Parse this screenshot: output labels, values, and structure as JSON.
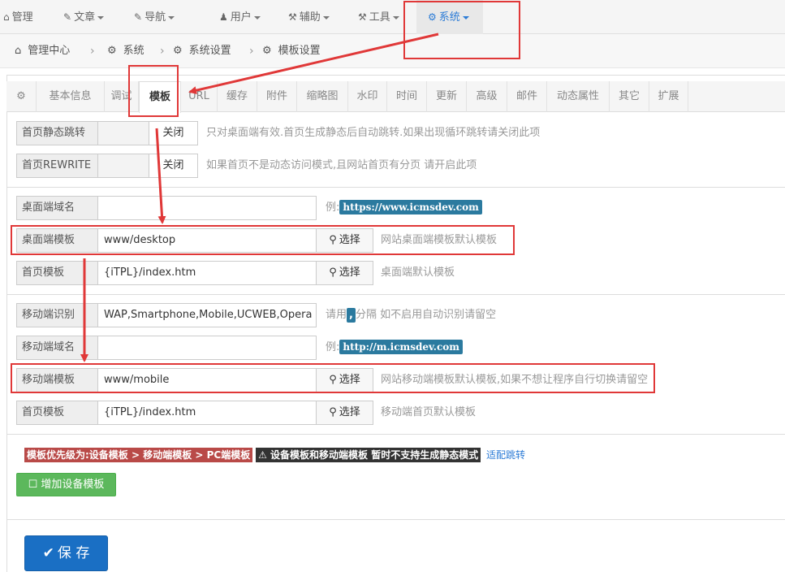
{
  "topnav": {
    "items": [
      {
        "label": "管理",
        "icon": "home-icon"
      },
      {
        "label": "文章",
        "icon": "edit-icon"
      },
      {
        "label": "导航",
        "icon": "edit-icon"
      },
      {
        "label": "用户",
        "icon": "user-icon"
      },
      {
        "label": "辅助",
        "icon": "gavel-icon"
      },
      {
        "label": "工具",
        "icon": "gavel-icon"
      },
      {
        "label": "系统",
        "icon": "gear-icon"
      }
    ]
  },
  "breadcrumb": {
    "items": [
      "管理中心",
      "系统",
      "系统设置",
      "模板设置"
    ]
  },
  "tabs": [
    "基本信息",
    "调试",
    "模板",
    "URL",
    "缓存",
    "附件",
    "缩略图",
    "水印",
    "时间",
    "更新",
    "高级",
    "邮件",
    "动态属性",
    "其它",
    "扩展"
  ],
  "form": {
    "static_jump": {
      "label": "首页静态跳转",
      "toggle": "关闭",
      "hint": "只对桌面端有效.首页生成静态后自动跳转.如果出现循环跳转请关闭此项"
    },
    "rewrite": {
      "label": "首页REWRITE",
      "toggle": "关闭",
      "hint": "如果首页不是动态访问模式,且网站首页有分页 请开启此项"
    },
    "desktop_domain": {
      "label": "桌面端域名",
      "value": "",
      "hint_prefix": "例:",
      "hint_badge": "https://www.icmsdev.com"
    },
    "desktop_template": {
      "label": "桌面端模板",
      "value": "www/desktop",
      "button": "选择",
      "hint": "网站桌面端模板默认模板"
    },
    "desktop_index": {
      "label": "首页模板",
      "value": "{iTPL}/index.htm",
      "button": "选择",
      "hint": "桌面端默认模板"
    },
    "mobile_ua": {
      "label": "移动端识别",
      "value": "WAP,Smartphone,Mobile,UCWEB,Opera M",
      "hint_prefix": "请用",
      "hint_badge": ",",
      "hint_suffix": "分隔 如不启用自动识别请留空"
    },
    "mobile_domain": {
      "label": "移动端域名",
      "value": "",
      "hint_prefix": "例:",
      "hint_badge": "http://m.icmsdev.com"
    },
    "mobile_template": {
      "label": "移动端模板",
      "value": "www/mobile",
      "button": "选择",
      "hint": "网站移动端模板默认模板,如果不想让程序自行切换请留空"
    },
    "mobile_index": {
      "label": "首页模板",
      "value": "{iTPL}/index.htm",
      "button": "选择",
      "hint": "移动端首页默认模板"
    }
  },
  "notes": {
    "priority": "模板优先级为:设备模板 > 移动端模板 > PC端模板",
    "warning": "设备模板和移动端模板 暂时不支持生成静态模式",
    "link": "适配跳转"
  },
  "buttons": {
    "add_device": "增加设备模板",
    "save": "保 存"
  },
  "colors": {
    "accent": "#2b7bd6",
    "annotation": "#e03838",
    "save": "#1a6fc4",
    "add": "#5cb85c"
  }
}
